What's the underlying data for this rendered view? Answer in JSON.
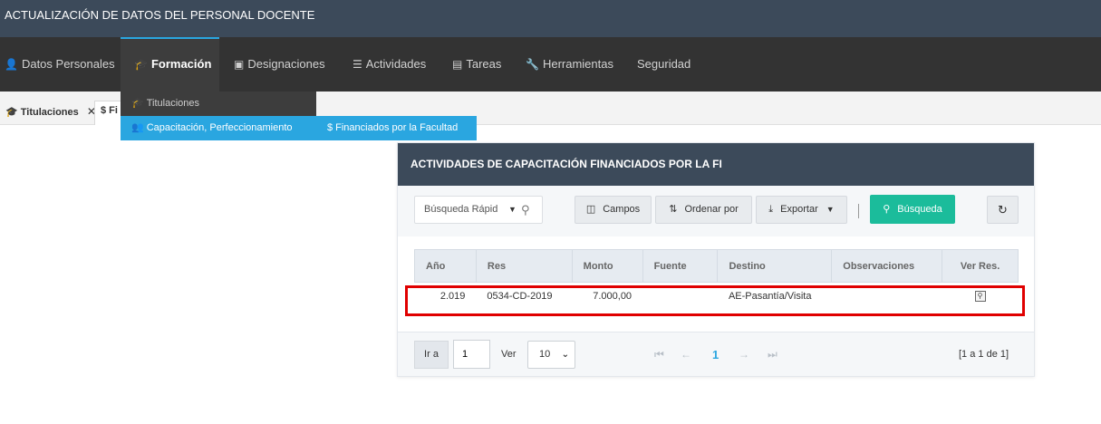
{
  "app": {
    "title": "ACTUALIZACIÓN DE DATOS DEL PERSONAL DOCENTE"
  },
  "nav": {
    "items": [
      {
        "label": "Datos Personales",
        "icon": "user-icon"
      },
      {
        "label": "Formación",
        "icon": "graduation-cap-icon",
        "active": true
      },
      {
        "label": "Designaciones",
        "icon": "id-card-icon"
      },
      {
        "label": "Actividades",
        "icon": "list-icon"
      },
      {
        "label": "Tareas",
        "icon": "clipboard-icon"
      },
      {
        "label": "Herramientas",
        "icon": "wrench-icon"
      },
      {
        "label": "Seguridad",
        "icon": ""
      }
    ]
  },
  "dropdown": {
    "titulaciones": "Titulaciones",
    "capacitacion": "Capacitación, Perfeccionamiento",
    "financiados": "Financiados por la Facultad"
  },
  "tabs": [
    {
      "label": "Titulaciones",
      "close": "✕"
    },
    {
      "label": "$ Fi"
    }
  ],
  "panel": {
    "title": "ACTIVIDADES DE CAPACITACIÓN FINANCIADOS POR LA FI",
    "toolbar": {
      "quick_search": "Búsqueda Rápid",
      "campos": "Campos",
      "ordenar": "Ordenar por",
      "exportar": "Exportar",
      "busqueda": "Búsqueda"
    },
    "columns": [
      "Año",
      "Res",
      "Monto",
      "Fuente",
      "Destino",
      "Observaciones",
      "Ver Res."
    ],
    "rows": [
      {
        "anio": "2.019",
        "res": "0534-CD-2019",
        "monto": "7.000,00",
        "fuente": "",
        "destino": "AE-Pasantía/Visita",
        "observaciones": ""
      }
    ],
    "pager": {
      "ir_a": "Ir a",
      "page_value": "1",
      "ver": "Ver",
      "per_page": "10",
      "current_page": "1",
      "range": "[1 a 1 de 1]"
    }
  },
  "colors": {
    "header_bg": "#3c4a5a",
    "nav_bg": "#333333",
    "accent": "#2aa6e0",
    "search_btn": "#1bbc9b",
    "highlight": "#e00000"
  }
}
